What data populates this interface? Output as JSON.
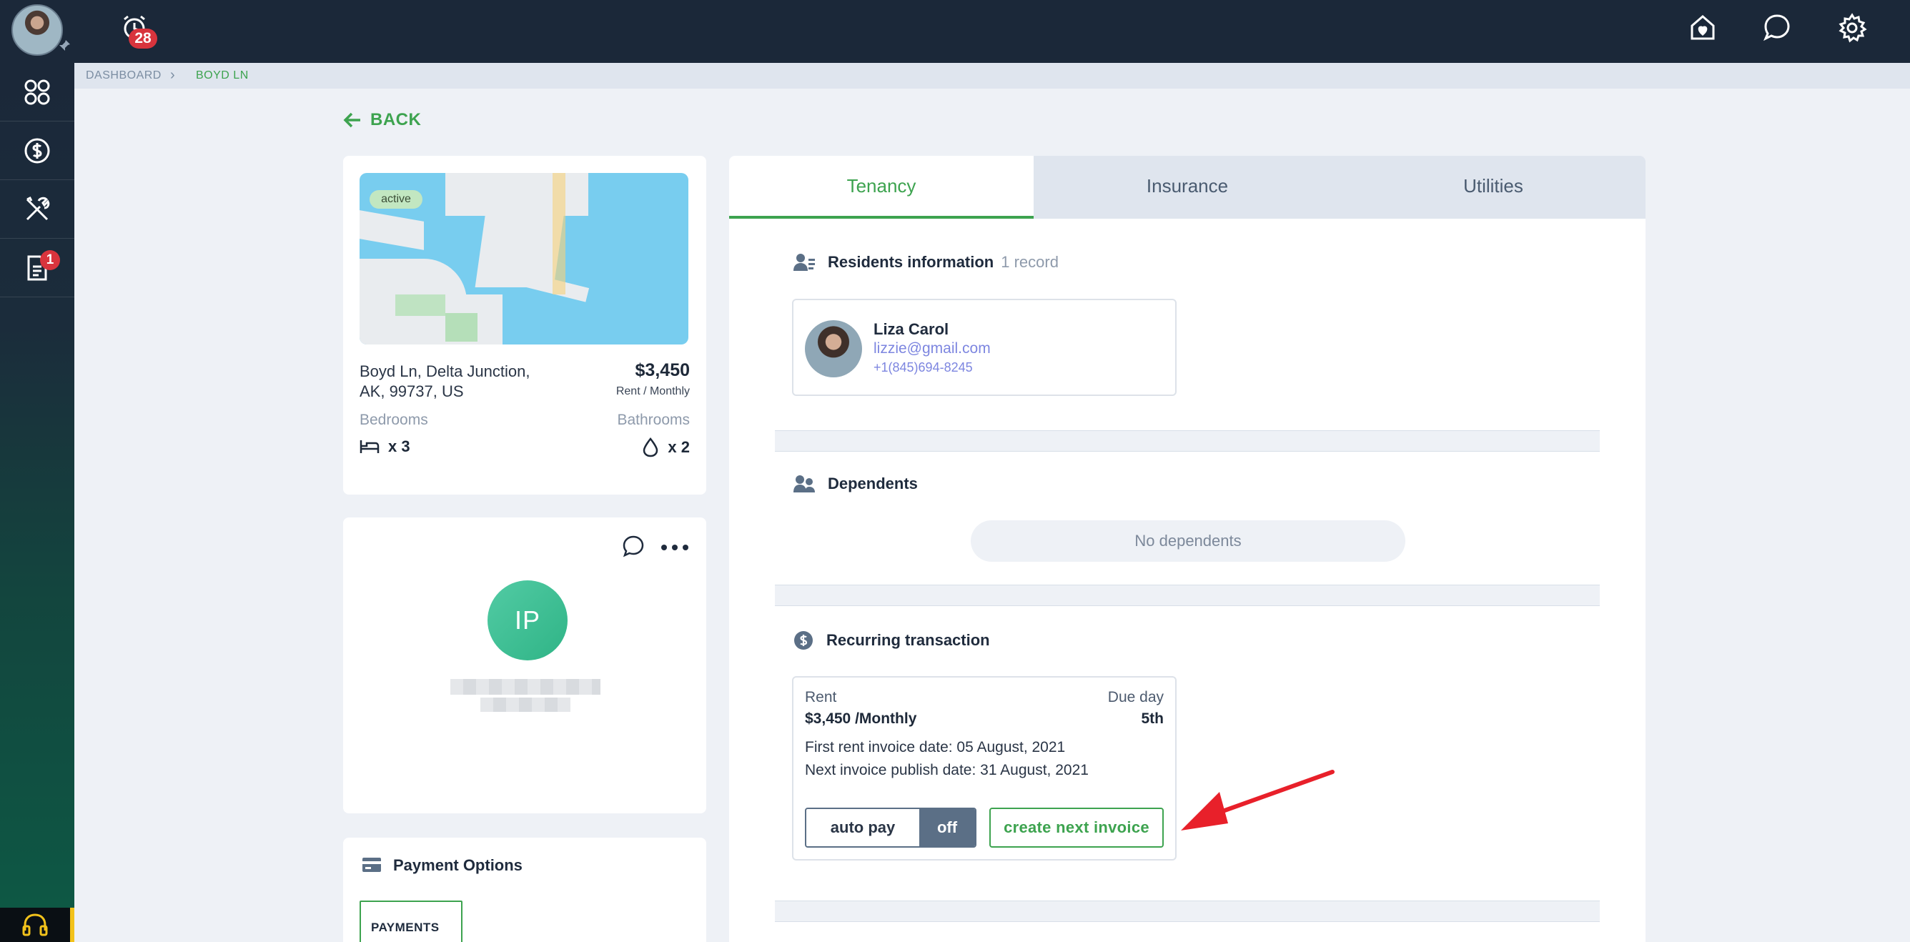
{
  "topbar": {
    "alarm_count": "28",
    "icons": [
      "user-avatar",
      "alarm-icon",
      "home-heart-icon",
      "chat-icon",
      "gear-icon"
    ]
  },
  "sidebar": {
    "items": [
      {
        "icon": "grid-icon"
      },
      {
        "icon": "dollar-icon"
      },
      {
        "icon": "tools-icon"
      },
      {
        "icon": "document-icon",
        "badge": "1"
      }
    ]
  },
  "breadcrumb": {
    "root": "DASHBOARD",
    "current": "BOYD LN"
  },
  "back_label": "BACK",
  "property": {
    "status": "active",
    "address_line1": "Boyd Ln, Delta Junction,",
    "address_line2": "AK, 99737, US",
    "price": "$3,450",
    "price_period": "Rent / Monthly",
    "bedrooms_label": "Bedrooms",
    "bedrooms_count": "x 3",
    "bathrooms_label": "Bathrooms",
    "bathrooms_count": "x 2"
  },
  "owner_card": {
    "initials": "IP"
  },
  "payment_options": {
    "title": "Payment Options",
    "logo_text": "PAYMENTS"
  },
  "tabs": [
    {
      "label": "Tenancy",
      "active": true
    },
    {
      "label": "Insurance",
      "active": false
    },
    {
      "label": "Utilities",
      "active": false
    }
  ],
  "residents": {
    "title": "Residents information",
    "count": "1 record",
    "items": [
      {
        "name": "Liza Carol",
        "email": "lizzie@gmail.com",
        "phone": "+1(845)694-8245"
      }
    ]
  },
  "dependents": {
    "title": "Dependents",
    "empty_text": "No dependents"
  },
  "recurring": {
    "title": "Recurring transaction",
    "rent_label": "Rent",
    "rent_value": "$3,450 /Monthly",
    "due_label": "Due day",
    "due_value": "5th",
    "first_invoice": "First rent invoice date: 05 August, 2021",
    "next_invoice": "Next invoice publish date: 31 August, 2021",
    "autopay_label": "auto pay",
    "autopay_state": "off",
    "create_button": "create next invoice"
  },
  "colors": {
    "accent": "#3da34f",
    "topbar": "#1b2839",
    "badge": "#d8343d",
    "link": "#7d86e0",
    "annotation_arrow": "#e8202a"
  }
}
